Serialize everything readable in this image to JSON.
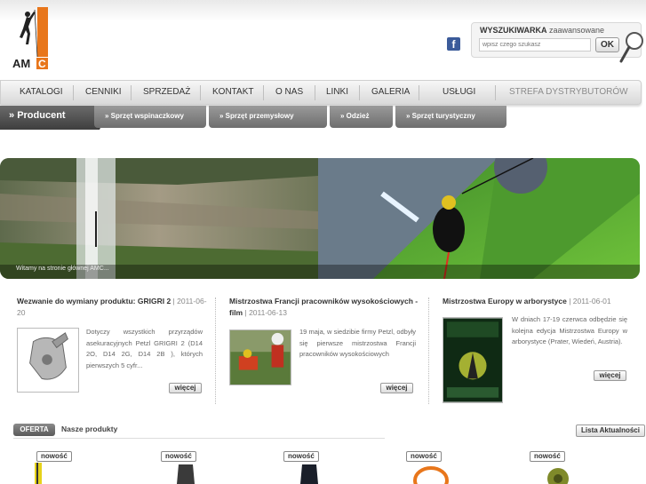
{
  "header": {
    "logo_text": "AMC",
    "search": {
      "title_bold": "WYSZUKIWARKA",
      "title_rest": "zaawansowane",
      "placeholder": "wpisz czego szukasz",
      "button_label": "OK"
    },
    "facebook_icon": "facebook-icon"
  },
  "nav": {
    "items": [
      "KATALOGI",
      "CENNIKI",
      "SPRZEDAŻ",
      "KONTAKT",
      "O NAS",
      "LINKI",
      "GALERIA",
      "USŁUGI",
      "STREFA DYSTRYBUTORÓW"
    ]
  },
  "subnav": {
    "active": "Producent",
    "tabs": [
      "Sprzęt wspinaczkowy",
      "Sprzęt przemysłowy",
      "Odzież",
      "Sprzęt turystyczny"
    ]
  },
  "banner": {
    "caption": "Witamy na stronie głównej AMC..."
  },
  "news": [
    {
      "title": "Wezwanie do wymiany produktu: GRIGRI 2",
      "date": "2011-06-20",
      "text": "Dotyczy wszystkich przyrządów asekuracyjnych Petzl GRIGRI 2 (D14 2O, D14 2G, D14 2B ), których pierwszych 5 cyfr...",
      "more": "więcej"
    },
    {
      "title": "Mistrzostwa Francji pracowników wysokościowych - film",
      "date": "2011-06-13",
      "text": "19 maja, w siedzibie firmy Petzl, odbyły się pierwsze mistrzostwa Francji pracowników wysokościowych",
      "more": "więcej"
    },
    {
      "title": "Mistrzostwa Europy w arborystyce",
      "date": "2011-06-01",
      "text": "W dniach 17-19 czerwca odbędzie się kolejna edycja Mistrzostwa Europy w arborystyce (Prater, Wiedeń, Austria).",
      "more": "więcej"
    }
  ],
  "products": {
    "tab_label": "OFERTA",
    "title": "Nasze produkty",
    "list_button": "Lista Aktualności",
    "badge": "nowość"
  },
  "colors": {
    "logo_orange": "#e8761b",
    "nav_dark": "#4a4a4a",
    "facebook_blue": "#3b5b9a"
  }
}
